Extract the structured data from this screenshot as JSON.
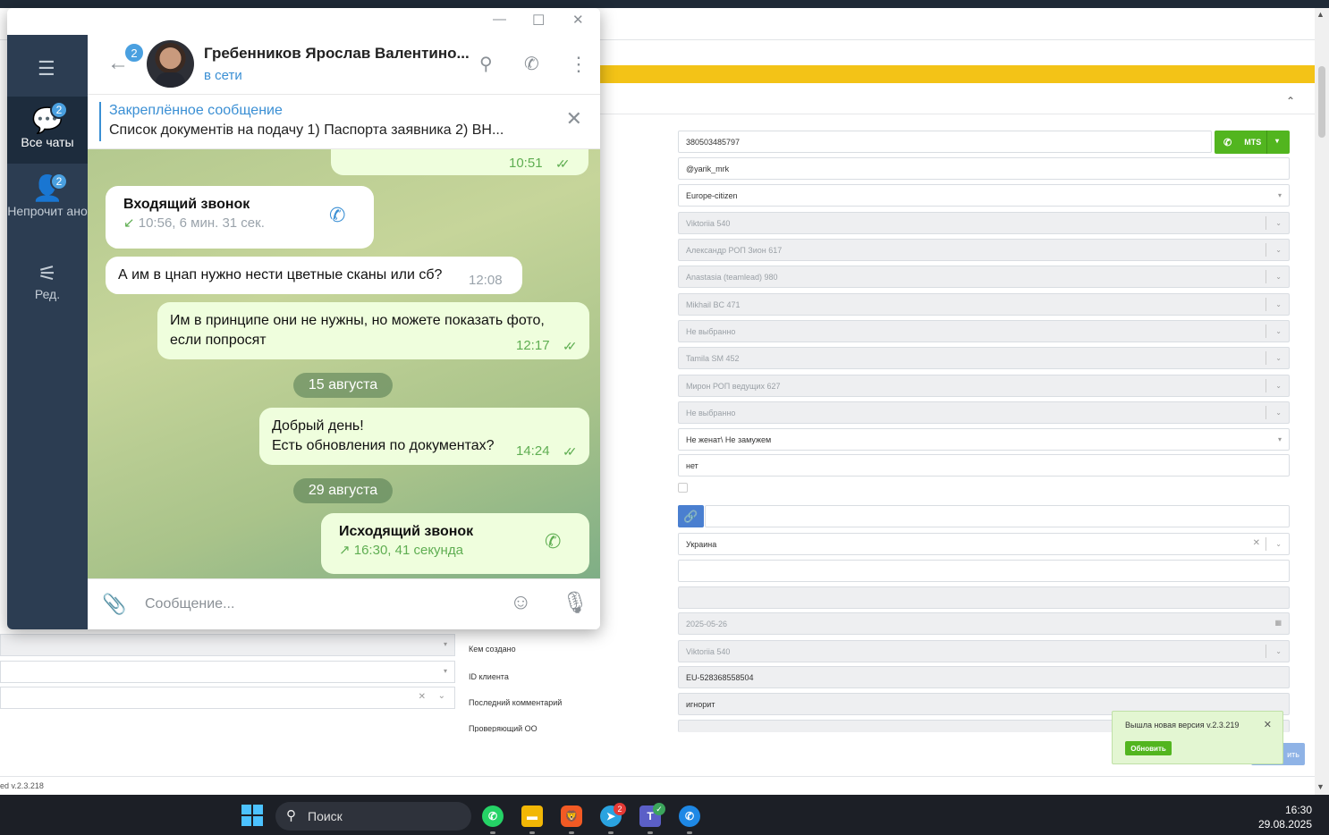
{
  "crm": {
    "fields": [
      {
        "value": "380503485797",
        "disabled": false
      },
      {
        "value": "@yarik_mrk",
        "disabled": false
      },
      {
        "value": "Europe-citizen",
        "disabled": false,
        "select": true
      },
      {
        "value": "Viktoriia 540",
        "disabled": true,
        "select": true
      },
      {
        "value": "Александр РОП Зион 617",
        "disabled": true,
        "select": true
      },
      {
        "value": "Anastasia (teamlead) 980",
        "disabled": true,
        "select": true
      },
      {
        "value": "Mikhail BC 471",
        "disabled": true,
        "select": true
      },
      {
        "value": "Не выбранно",
        "disabled": true,
        "select": true
      },
      {
        "value": "Tamila SM 452",
        "disabled": true,
        "select": true
      },
      {
        "value": "Мирон РОП ведущих 627",
        "disabled": true,
        "select": true
      },
      {
        "value": "Не выбранно",
        "disabled": true,
        "select": true
      },
      {
        "value": "Не женат\\ Не замужем",
        "disabled": false,
        "select": true
      },
      {
        "value": "нет",
        "disabled": false
      }
    ],
    "country": "Украина",
    "date_value": "2025-05-26",
    "created_by_label": "Кем создано",
    "created_by_value": "Viktoriia 540",
    "client_id_label": "ID клиента",
    "client_id_value": "EU-528368558504",
    "last_comment_label": "Последний комментарий",
    "last_comment_value": "игнорит",
    "checking_label": "Проверяющий ОО",
    "mts_label": "MTS",
    "version": "ed v.2.3.218",
    "toast_message": "Вышла новая версия v.2.3.219",
    "toast_update": "Обновить",
    "save_label": "ить"
  },
  "telegram": {
    "sidebar": [
      {
        "label": "Все чаты",
        "badge": "2"
      },
      {
        "label": "Непрочит ано",
        "badge": "2"
      },
      {
        "label": "Ред.",
        "badge": ""
      }
    ],
    "header": {
      "back_badge": "2",
      "name": "Гребенников Ярослав Валентино...",
      "status": "в сети"
    },
    "pinned": {
      "title": "Закреплённое сообщение",
      "text": "Список документів на подачу  1) Паспорта заявника  2) ВН..."
    },
    "messages": {
      "top_time": "10:51",
      "incoming_call_title": "Входящий звонок",
      "incoming_call_sub": "10:56, 6 мин. 31 сек.",
      "msg1_text": "А им в цнап нужно нести цветные сканы или сб?",
      "msg1_time": "12:08",
      "msg2_line1": "Им в принципе они не нужны, но можете показать фото,",
      "msg2_line2": "если попросят",
      "msg2_time": "12:17",
      "date1": "15 августа",
      "msg3_line1": "Добрый день!",
      "msg3_line2": "Есть обновления по документах?",
      "msg3_time": "14:24",
      "date2": "29 августа",
      "outgoing_call_title": "Исходящий звонок",
      "outgoing_call_sub": "16:30, 41 секунда"
    },
    "composer_placeholder": "Сообщение..."
  },
  "taskbar": {
    "search_label": "Поиск",
    "telegram_badge": "2",
    "time": "16:30",
    "date": "29.08.2025"
  },
  "colors": {
    "accent_blue": "#3a8fd4",
    "crm_green": "#52b51f",
    "crm_yellow": "#f3c317",
    "tg_sidebar": "#2c3d52"
  }
}
